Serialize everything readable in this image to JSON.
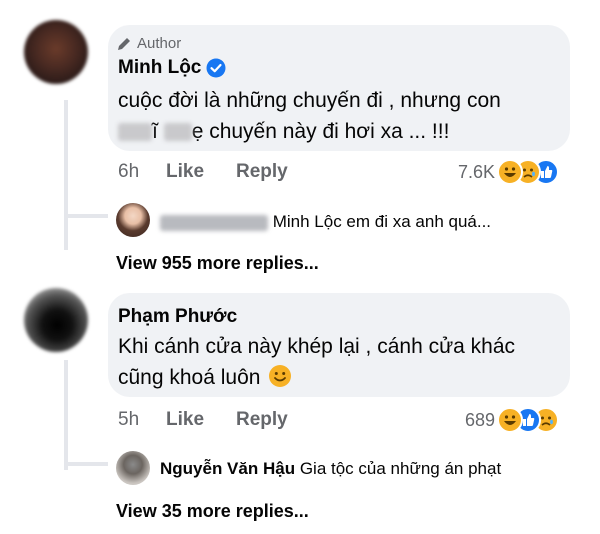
{
  "comments": [
    {
      "author_badge": "Author",
      "name": "Minh Lộc",
      "verified": true,
      "text_line1": "cuộc đời là những chuyến đi , nhưng con",
      "text_line2_prefix": "ĩ",
      "text_line2_rest": "ẹ chuyến này đi hơi xa ... !!!",
      "time": "6h",
      "like_label": "Like",
      "reply_label": "Reply",
      "reaction_count": "7.6K",
      "reactions": [
        "haha-icon",
        "sad-icon",
        "like-icon"
      ],
      "reply_preview": {
        "name": "",
        "text": "Minh Lộc em đi xa anh quá..."
      },
      "view_more": "View 955 more replies..."
    },
    {
      "name": "Phạm Phước",
      "text_line1": "Khi cánh cửa này khép lại , cánh cửa khác",
      "text_line2": "cũng khoá luôn",
      "emoji": "smile-emoji",
      "time": "5h",
      "like_label": "Like",
      "reply_label": "Reply",
      "reaction_count": "689",
      "reactions": [
        "haha-icon",
        "like-icon",
        "sad-icon"
      ],
      "reply_preview": {
        "name": "Nguyễn Văn Hậu",
        "text": "Gia tộc của những án phạt"
      },
      "view_more": "View 35 more replies..."
    }
  ],
  "colors": {
    "bubble": "#f0f2f5",
    "meta": "#65676b",
    "verified": "#1877f2",
    "haha": "#f7b125",
    "like": "#1877f2"
  }
}
